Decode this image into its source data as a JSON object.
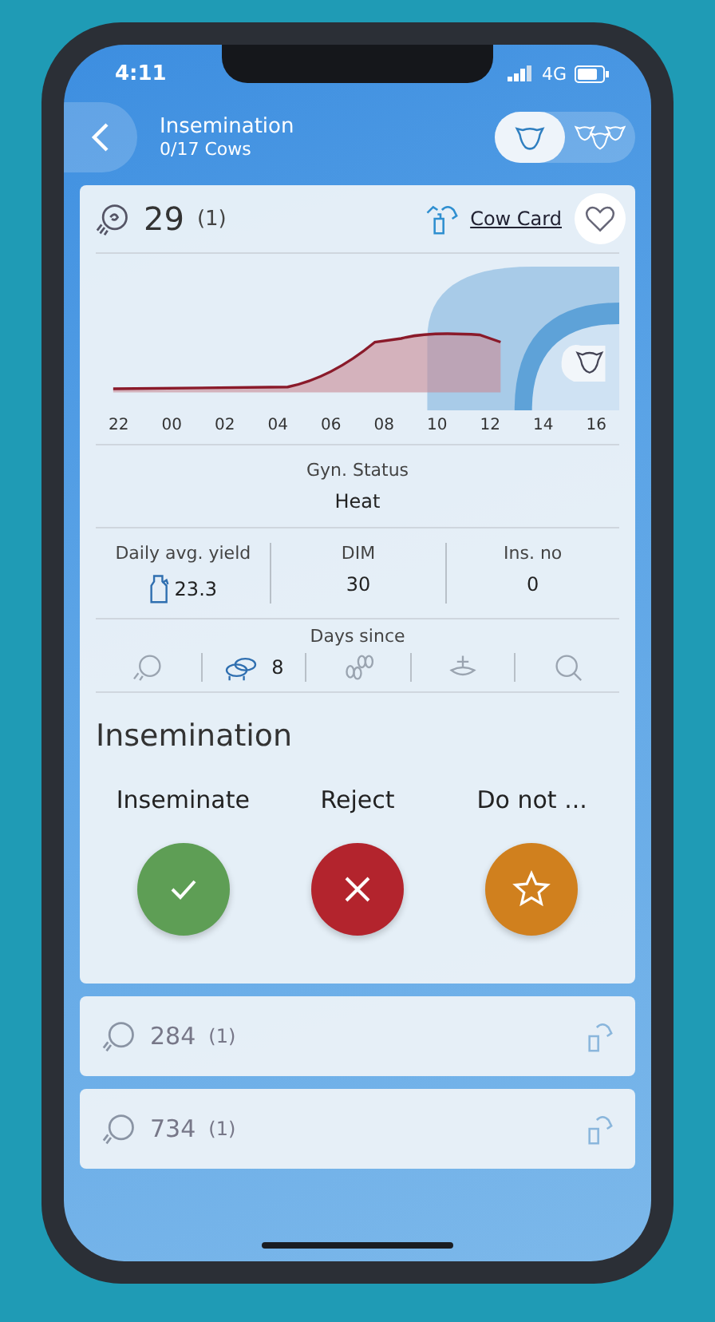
{
  "status_bar": {
    "time": "4:11",
    "network": "4G"
  },
  "header": {
    "title": "Insemination",
    "subtitle": "0/17 Cows",
    "view_toggle": [
      {
        "kind": "single",
        "selected": true
      },
      {
        "kind": "group",
        "selected": false
      }
    ]
  },
  "current_cow": {
    "number": "29",
    "lactation": "(1)",
    "link": "Cow Card",
    "favorite": false,
    "chart_x_labels": [
      "22",
      "00",
      "02",
      "04",
      "06",
      "08",
      "10",
      "12",
      "14",
      "16"
    ],
    "gyn_status": {
      "label": "Gyn. Status",
      "value": "Heat"
    },
    "stats": [
      {
        "kind": "yield",
        "label": "Daily avg. yield",
        "value": "23.3"
      },
      {
        "kind": "plain",
        "label": "DIM",
        "value": "30"
      },
      {
        "kind": "plain",
        "label": "Ins. no",
        "value": "0"
      }
    ],
    "days_since": {
      "label": "Days since",
      "items": [
        {
          "kind": "heat",
          "active": false
        },
        {
          "kind": "mounting",
          "active": true,
          "value": "8"
        },
        {
          "kind": "feet",
          "active": false
        },
        {
          "kind": "insemination",
          "active": false
        },
        {
          "kind": "pregnancy",
          "active": false
        }
      ]
    }
  },
  "insemination": {
    "title": "Insemination",
    "actions": [
      {
        "kind": "accept",
        "label": "Inseminate"
      },
      {
        "kind": "reject",
        "label": "Reject"
      },
      {
        "kind": "skip",
        "label": "Do not ..."
      }
    ]
  },
  "queue": [
    {
      "number": "284",
      "lactation": "(1)"
    },
    {
      "number": "734",
      "lactation": "(1)"
    }
  ]
}
